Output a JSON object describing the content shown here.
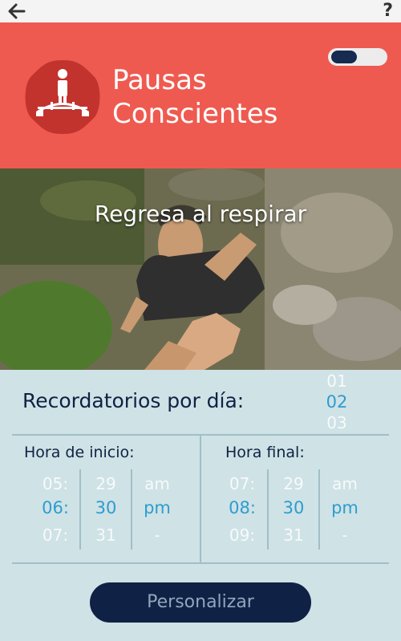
{
  "topbar": {
    "back_icon": "arrow-left-icon",
    "help_label": "?"
  },
  "header": {
    "title_line1": "Pausas",
    "title_line2": "Conscientes",
    "logo_icon": "person-on-bridge-icon",
    "toggle_state": "off",
    "brand_color": "#ef5a50"
  },
  "banner": {
    "caption": "Regresa al respirar"
  },
  "reminders": {
    "label": "Recordatorios por día:",
    "picker": {
      "prev": "01",
      "selected": "02",
      "next": "03"
    }
  },
  "start_time": {
    "label": "Hora de inicio:",
    "hour": {
      "prev": "05:",
      "selected": "06:",
      "next": "07:"
    },
    "minute": {
      "prev": "29",
      "selected": "30",
      "next": "31"
    },
    "ampm": {
      "prev": "am",
      "selected": "pm",
      "next": "-"
    }
  },
  "end_time": {
    "label": "Hora final:",
    "hour": {
      "prev": "07:",
      "selected": "08:",
      "next": "09:"
    },
    "minute": {
      "prev": "29",
      "selected": "30",
      "next": "31"
    },
    "ampm": {
      "prev": "am",
      "selected": "pm",
      "next": "-"
    }
  },
  "customize_button": "Personalizar",
  "accent_color": "#2d9dd0",
  "dark_color": "#0f2245"
}
